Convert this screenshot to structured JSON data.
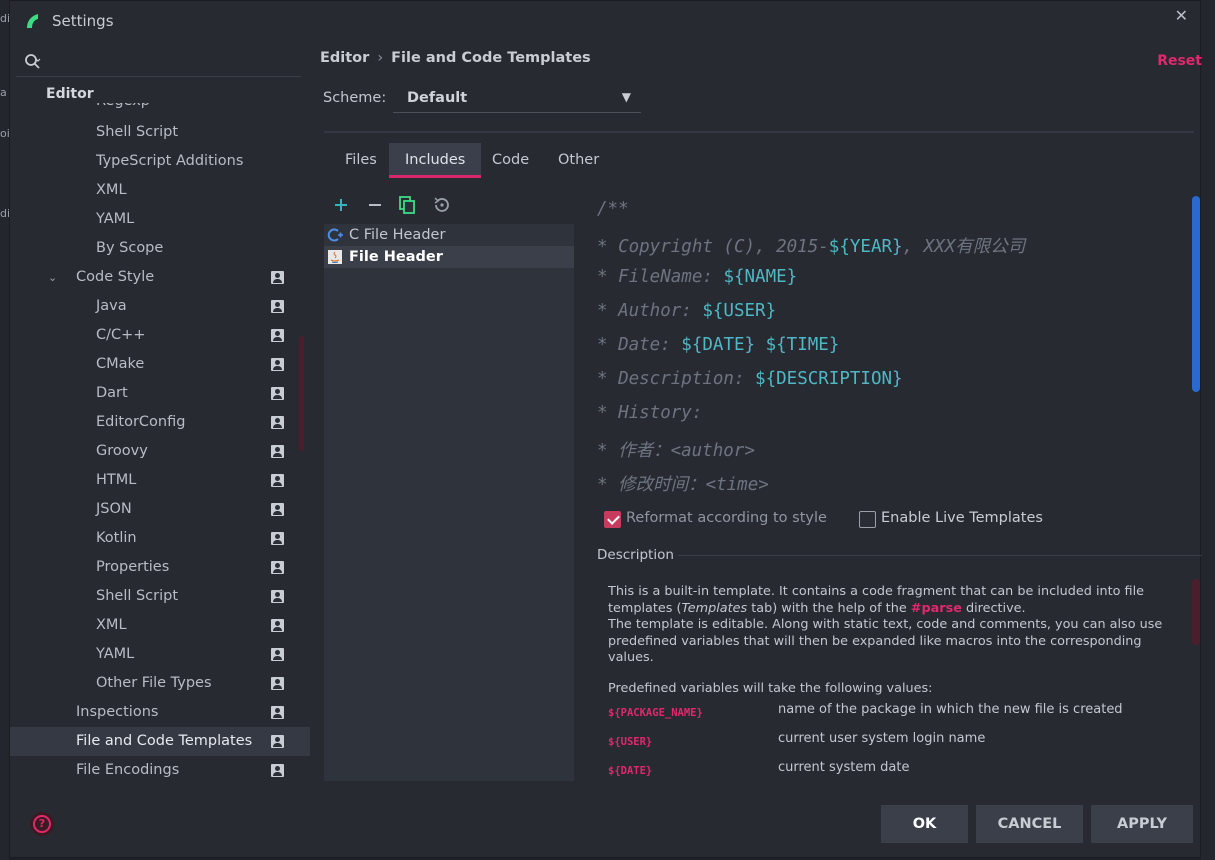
{
  "window": {
    "title": "Settings"
  },
  "edge_fragments": [
    "di",
    "a",
    "oi",
    "di"
  ],
  "left": {
    "section": "Editor",
    "items": [
      {
        "label": "Regexp"
      },
      {
        "label": "Shell Script"
      },
      {
        "label": "TypeScript Additions"
      },
      {
        "label": "XML"
      },
      {
        "label": "YAML"
      },
      {
        "label": "By Scope"
      },
      {
        "label": "Code Style"
      },
      {
        "label": "Java"
      },
      {
        "label": "C/C++"
      },
      {
        "label": "CMake"
      },
      {
        "label": "Dart"
      },
      {
        "label": "EditorConfig"
      },
      {
        "label": "Groovy"
      },
      {
        "label": "HTML"
      },
      {
        "label": "JSON"
      },
      {
        "label": "Kotlin"
      },
      {
        "label": "Properties"
      },
      {
        "label": "Shell Script"
      },
      {
        "label": "XML"
      },
      {
        "label": "YAML"
      },
      {
        "label": "Other File Types"
      },
      {
        "label": "Inspections"
      },
      {
        "label": "File and Code Templates"
      },
      {
        "label": "File Encodings"
      }
    ]
  },
  "breadcrumb": {
    "part1": "Editor",
    "separator": "›",
    "part2": "File and Code Templates"
  },
  "reset_label": "Reset",
  "scheme": {
    "label": "Scheme:",
    "value": "Default"
  },
  "tabs": [
    "Files",
    "Includes",
    "Code",
    "Other"
  ],
  "active_tab": "Includes",
  "templates": [
    {
      "name": "C File Header",
      "icon": "c-file-icon"
    },
    {
      "name": "File Header",
      "icon": "java-file-icon"
    }
  ],
  "code": {
    "l1": "/**",
    "l2_prefix": "* Copyright (C), 2015-",
    "l2_var": "${YEAR}",
    "l2_suffix": ", XXX有限公司",
    "l3_prefix": "* FileName: ",
    "l3_var": "${NAME}",
    "l4_prefix": "* Author: ",
    "l4_var": "${USER}",
    "l5_prefix": "* Date: ",
    "l5_var1": "${DATE}",
    "l5_var2": "${TIME}",
    "l6_prefix": "* Description: ",
    "l6_var": "${DESCRIPTION}",
    "l7": "* History:",
    "l8": "* 作者：<author>",
    "l9": "* 修改时间：<time>"
  },
  "options": {
    "reformat": {
      "label": "Reformat according to style",
      "checked": true
    },
    "live_templates": {
      "label": "Enable Live Templates",
      "checked": false
    }
  },
  "description": {
    "title": "Description",
    "p1_a": "This is a built-in template. It contains a code fragment that can be included into file templates (",
    "p1_em": "Templates",
    "p1_b": " tab) with the help of the ",
    "p1_dir": "#parse",
    "p1_c": " directive.",
    "p1_d": "The template is editable. Along with static text, code and comments, you can also use predefined variables that will then be expanded like macros into the corresponding values.",
    "p2": "Predefined variables will take the following values:",
    "vars": [
      {
        "name": "${PACKAGE_NAME}",
        "desc": "name of the package in which the new file is created"
      },
      {
        "name": "${USER}",
        "desc": "current user system login name"
      },
      {
        "name": "${DATE}",
        "desc": "current system date"
      }
    ]
  },
  "buttons": {
    "ok": "OK",
    "cancel": "CANCEL",
    "apply": "APPLY"
  },
  "colors": {
    "accent": "#e2286c",
    "variable": "#4fb7c5",
    "scrollbar": "#2a6ad0"
  }
}
